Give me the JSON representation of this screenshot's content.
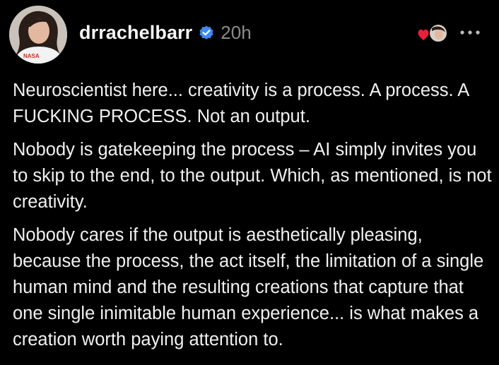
{
  "post": {
    "username": "drrachelbarr",
    "timestamp": "20h",
    "avatar_shirt_text": "NASA",
    "icons": {
      "verified": "verified-badge-icon",
      "reaction": "heart-reaction-icon",
      "more": "more-options-icon"
    },
    "paragraphs": [
      "Neuroscientist here... creativity is a process. A process. A FUCKING PROCESS. Not an output.",
      "Nobody is gatekeeping the process – AI simply invites you to skip to the end, to the output. Which, as mentioned, is not creativity.",
      "Nobody cares if the output is aesthetically pleasing, because the process, the act itself, the limitation of a single human mind and the resulting creations that capture that one single inimitable human experience... is what makes a creation worth paying attention to."
    ]
  },
  "colors": {
    "background": "#000000",
    "text": "#f1f1f1",
    "muted": "#8a8a8a",
    "verified": "#3d8bf2",
    "heart": "#e8203a"
  }
}
